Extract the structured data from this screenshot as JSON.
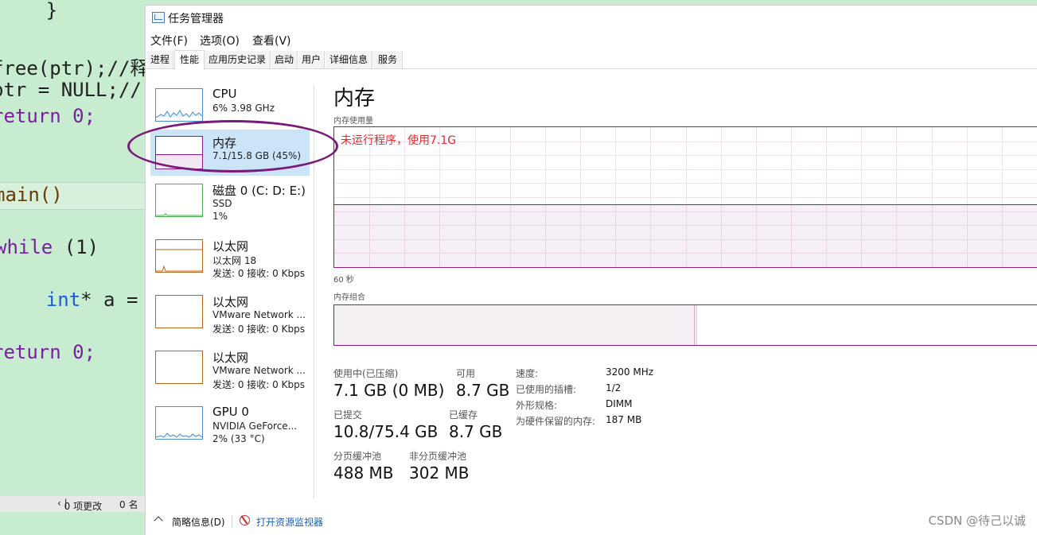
{
  "editor": {
    "lines": [
      "    }",
      "}",
      "free(ptr);//释",
      "ptr = NULL;//",
      "return 0;",
      "main()",
      "while",
      " (1)",
      "{",
      "    int",
      "* a = ",
      "}",
      "return 0;"
    ],
    "status": {
      "col1": "0 项更改",
      "col2": "0 名"
    }
  },
  "window": {
    "title": "任务管理器",
    "menu": [
      "文件(F)",
      "选项(O)",
      "查看(V)"
    ],
    "tabs": [
      "进程",
      "性能",
      "应用历史记录",
      "启动",
      "用户",
      "详细信息",
      "服务"
    ],
    "active_tab": "性能"
  },
  "sidebar": {
    "items": [
      {
        "title": "CPU",
        "sub": "6% 3.98 GHz",
        "sub2": ""
      },
      {
        "title": "内存",
        "sub": "7.1/15.8 GB (45%)",
        "sub2": ""
      },
      {
        "title": "磁盘 0 (C: D: E:)",
        "sub": "SSD",
        "sub2": "1%"
      },
      {
        "title": "以太网",
        "sub": "以太网 18",
        "sub2": "发送: 0 接收: 0 Kbps"
      },
      {
        "title": "以太网",
        "sub": "VMware Network ...",
        "sub2": "发送: 0 接收: 0 Kbps"
      },
      {
        "title": "以太网",
        "sub": "VMware Network ...",
        "sub2": "发送: 0 接收: 0 Kbps"
      },
      {
        "title": "GPU 0",
        "sub": "NVIDIA GeForce...",
        "sub2": "2% (33 °C)"
      }
    ]
  },
  "memory": {
    "title": "内存",
    "usage_label": "内存使用量",
    "usage_fraction": 0.45,
    "annotation": "未运行程序，使用7.1G",
    "time_label": "60 秒",
    "composition_label": "内存组合",
    "stats": {
      "in_use_label": "使用中(已压缩)",
      "in_use_value": "7.1 GB (0 MB)",
      "available_label": "可用",
      "available_value": "8.7 GB",
      "committed_label": "已提交",
      "committed_value": "10.8/75.4 GB",
      "cached_label": "已缓存",
      "cached_value": "8.7 GB",
      "paged_label": "分页缓冲池",
      "paged_value": "488 MB",
      "nonpaged_label": "非分页缓冲池",
      "nonpaged_value": "302 MB"
    },
    "details": [
      {
        "key": "速度:",
        "value": "3200 MHz"
      },
      {
        "key": "已使用的插槽:",
        "value": "1/2"
      },
      {
        "key": "外形规格:",
        "value": "DIMM"
      },
      {
        "key": "为硬件保留的内存:",
        "value": "187 MB"
      }
    ]
  },
  "footer": {
    "summary": "简略信息(D)",
    "resmon": "打开资源监视器"
  },
  "watermark": "CSDN @待己以诚",
  "colors": {
    "memory_accent": "#8b1a8b",
    "cpu_accent": "#4a90c8",
    "disk_accent": "#4caf50",
    "net_accent": "#b8651b",
    "annotation": "#e02a2a"
  }
}
